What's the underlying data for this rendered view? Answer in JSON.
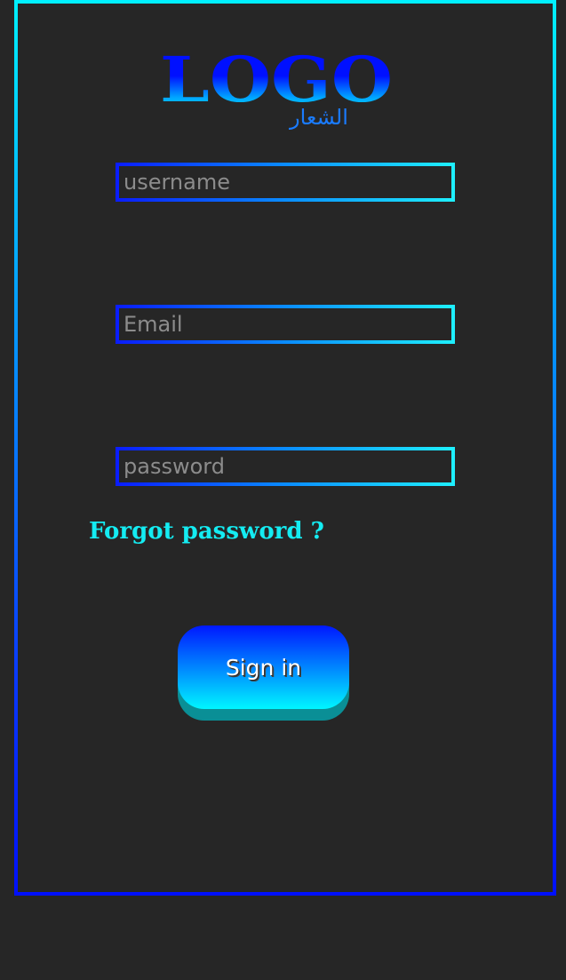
{
  "logo": {
    "text": "LOGO",
    "subtitle": "الشعار"
  },
  "form": {
    "username_placeholder": "username",
    "email_placeholder": "Email",
    "password_placeholder": "password",
    "forgot_label": "Forgot password ?",
    "signin_label": "Sign in"
  },
  "colors": {
    "background": "#262626",
    "accent_cyan": "#14ecf2",
    "accent_blue": "#0018ff",
    "button_shadow": "#0a8f96"
  }
}
